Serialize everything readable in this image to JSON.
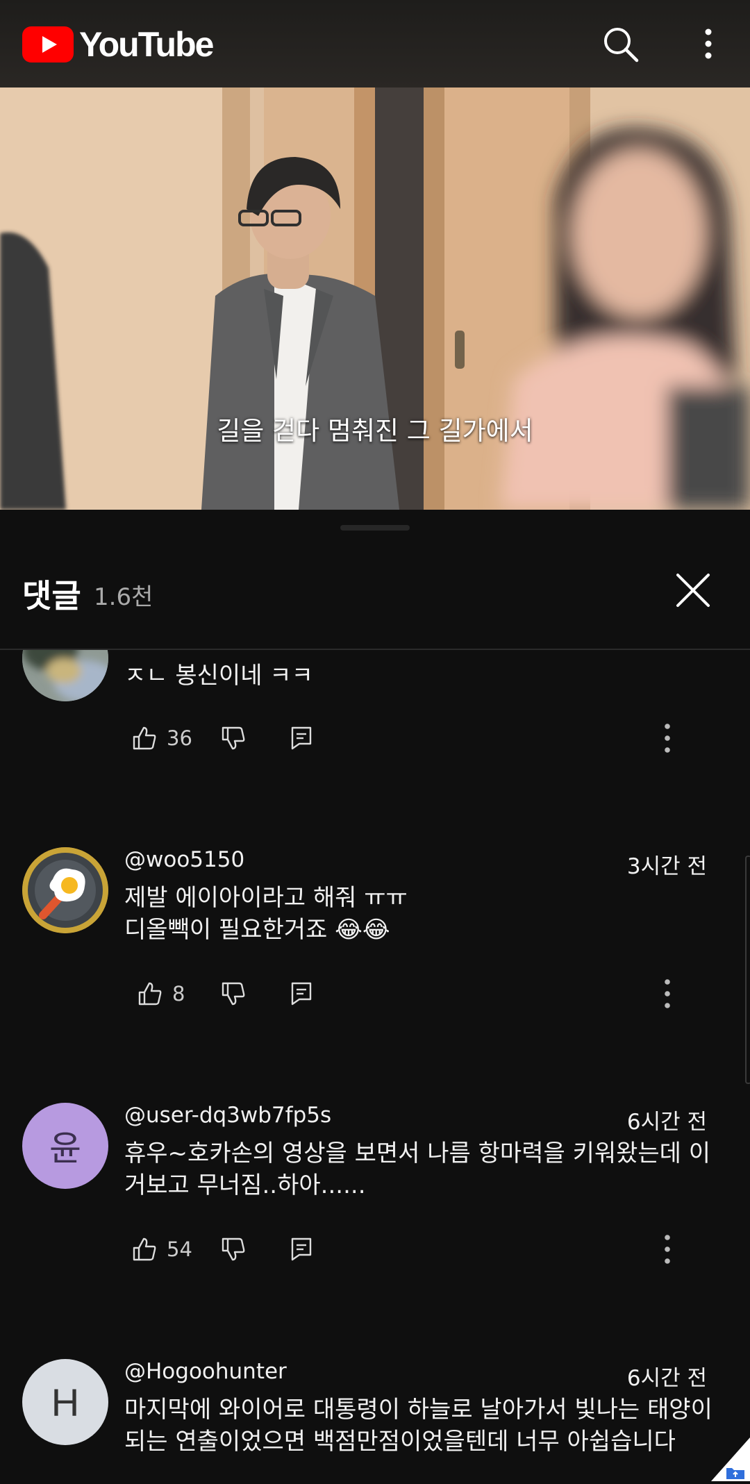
{
  "topbar": {
    "logo_text": "YouTube",
    "search_icon": "search-icon",
    "more_icon": "more-vert-icon"
  },
  "video": {
    "subtitle": "길을 걷다 멈춰진 그 길가에서"
  },
  "comments_panel": {
    "title": "댓글",
    "count": "1.6천",
    "close_icon": "close-icon"
  },
  "comments": [
    {
      "author": "",
      "time": "",
      "text": "ㅈㄴ 봉신이네 ㅋㅋ",
      "likes": "36",
      "avatar_letter": ""
    },
    {
      "author": "@woo5150",
      "time": "3시간 전",
      "text_lines": [
        "제발 에이아이라고 해줘 ㅠㅠ",
        "디올빽이 필요한거죠 😂😂"
      ],
      "likes": "8",
      "avatar_letter": ""
    },
    {
      "author": "@user-dq3wb7fp5s",
      "time": "6시간 전",
      "text_lines": [
        "휴우~호카손의 영상을 보면서 나름 항마력을 키워왔는데 이",
        "거보고 무너짐..하아......"
      ],
      "likes": "54",
      "avatar_letter": "윤"
    },
    {
      "author": "@Hogoohunter",
      "time": "6시간 전",
      "text_lines": [
        "마지막에 와이어로 대통령이 하늘로 날아가서 빛나는 태양이",
        "되는 연출이었으면 백점만점이었을텐데 너무 아쉽습니다"
      ],
      "likes": "",
      "avatar_letter": "H"
    }
  ],
  "colors": {
    "background": "#0f0f0f",
    "brand_red": "#ff0000",
    "secondary_text": "#aaaaaa",
    "avatar_purple": "#b79ae0",
    "avatar_gray": "#d9dde3"
  }
}
